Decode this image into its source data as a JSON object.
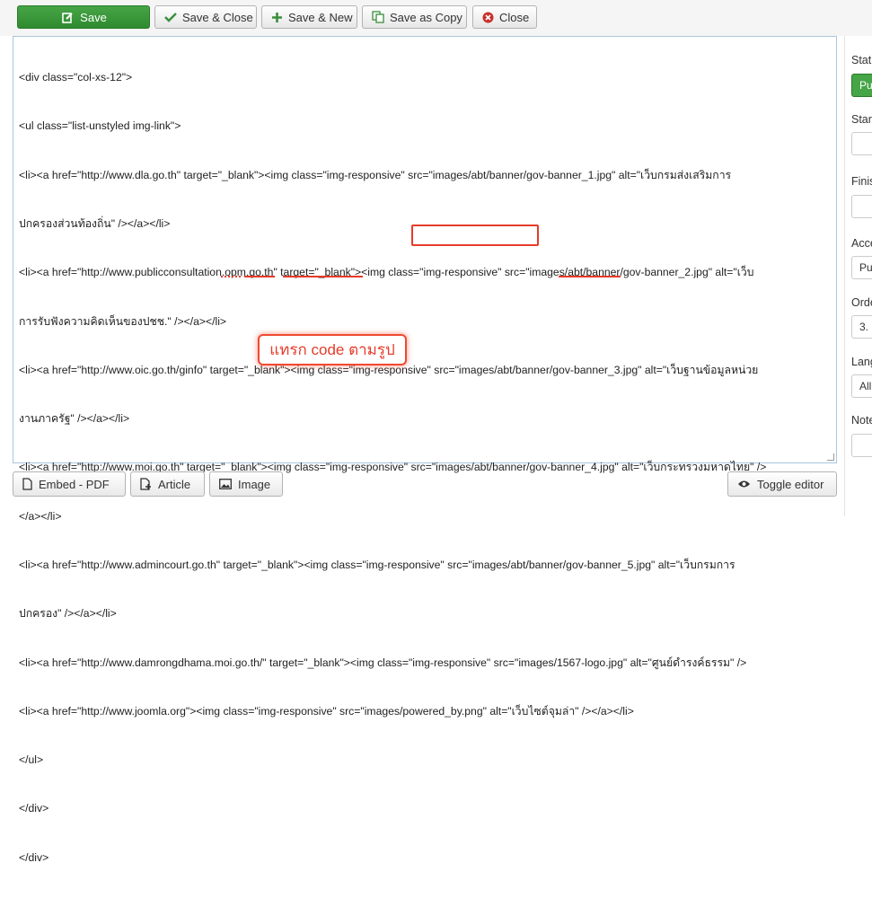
{
  "toolbar": {
    "save": "Save",
    "save_close": "Save & Close",
    "save_new": "Save & New",
    "save_copy": "Save as Copy",
    "close": "Close"
  },
  "editor": {
    "lines": [
      "<div class=\"col-xs-12\">",
      "<ul class=\"list-unstyled img-link\">",
      "<li><a href=\"http://www.dla.go.th\" target=\"_blank\"><img class=\"img-responsive\" src=\"images/abt/banner/gov-banner_1.jpg\" alt=\"เว็บกรมส่งเสริมการ",
      "ปกครองส่วนท้องถิ่น\" /></a></li>",
      "<li><a href=\"http://www.publicconsultation.opm.go.th\" target=\"_blank\"><img class=\"img-responsive\" src=\"images/abt/banner/gov-banner_2.jpg\" alt=\"เว็บ",
      "การรับฟังความคิดเห็นของปชช.\" /></a></li>",
      "<li><a href=\"http://www.oic.go.th/ginfo\" target=\"_blank\"><img class=\"img-responsive\" src=\"images/abt/banner/gov-banner_3.jpg\" alt=\"เว็บฐานข้อมูลหน่วย",
      "งานภาครัฐ\" /></a></li>",
      "<li><a href=\"http://www.moi.go.th\" target=\"_blank\"><img class=\"img-responsive\" src=\"images/abt/banner/gov-banner_4.jpg\" alt=\"เว็บกระทรวงมหาดไทย\" />",
      "</a></li>",
      "<li><a href=\"http://www.admincourt.go.th\" target=\"_blank\"><img class=\"img-responsive\" src=\"images/abt/banner/gov-banner_5.jpg\" alt=\"เว็บกรมการ",
      "ปกครอง\" /></a></li>",
      "<li><a href=\"http://www.damrongdhama.moi.go.th/\" target=\"_blank\"><img class=\"img-responsive\" src=\"images/1567-logo.jpg\" alt=\"ศูนย์ดำรงค์ธรรม\" />",
      "<li><a href=\"http://www.joomla.org\"><img class=\"img-responsive\" src=\"images/powered_by.png\" alt=\"เว็บไซต์จุมล่า\" /></a></li>",
      "</ul>",
      "</div>",
      "</div>"
    ],
    "annotation": "แทรก code ตามรูป"
  },
  "bottom_buttons": {
    "embed_pdf": "Embed - PDF",
    "article": "Article",
    "image": "Image",
    "toggle_editor": "Toggle editor"
  },
  "sidebar": {
    "status_label": "Stat",
    "status_value": "Pu",
    "start_label": "Star",
    "finish_label": "Finis",
    "access_label": "Acce",
    "access_value": "Pu",
    "ordering_label": "Orde",
    "ordering_value": "3.",
    "language_label": "Lang",
    "language_value": "All",
    "note_label": "Note"
  },
  "colors": {
    "primary_green": "#46a546",
    "annotation_red": "#e53b2a"
  }
}
